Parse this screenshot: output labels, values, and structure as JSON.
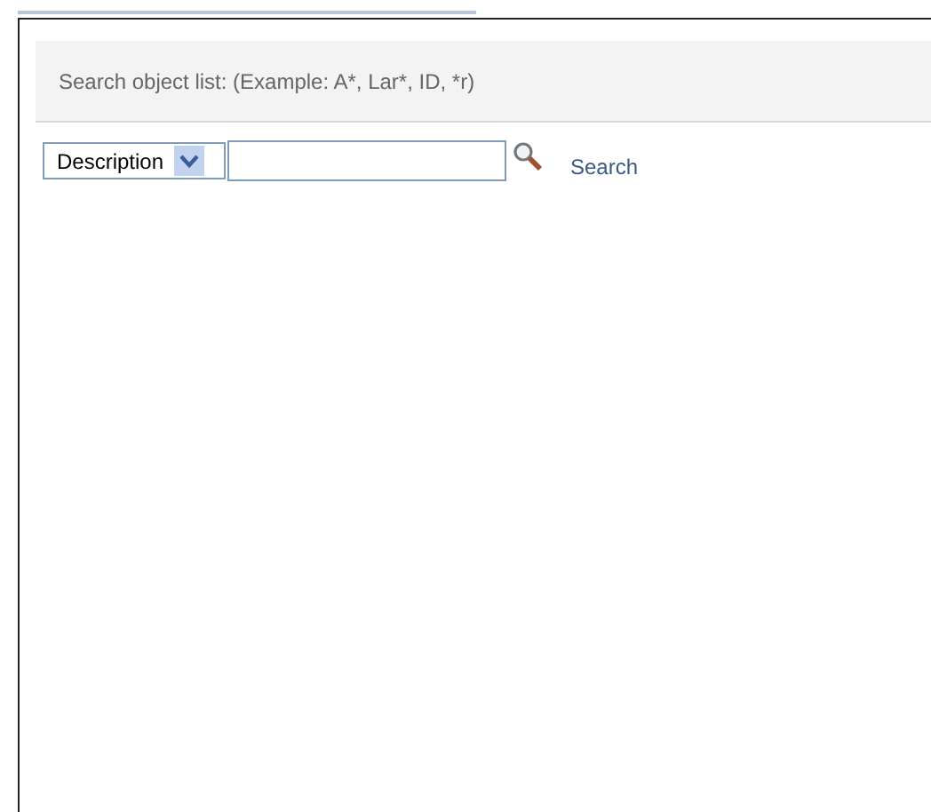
{
  "dialog": {
    "instruction": "Search object list: (Example: A*, Lar*, ID, *r)"
  },
  "search": {
    "field_select": "Description",
    "button": "Search"
  }
}
